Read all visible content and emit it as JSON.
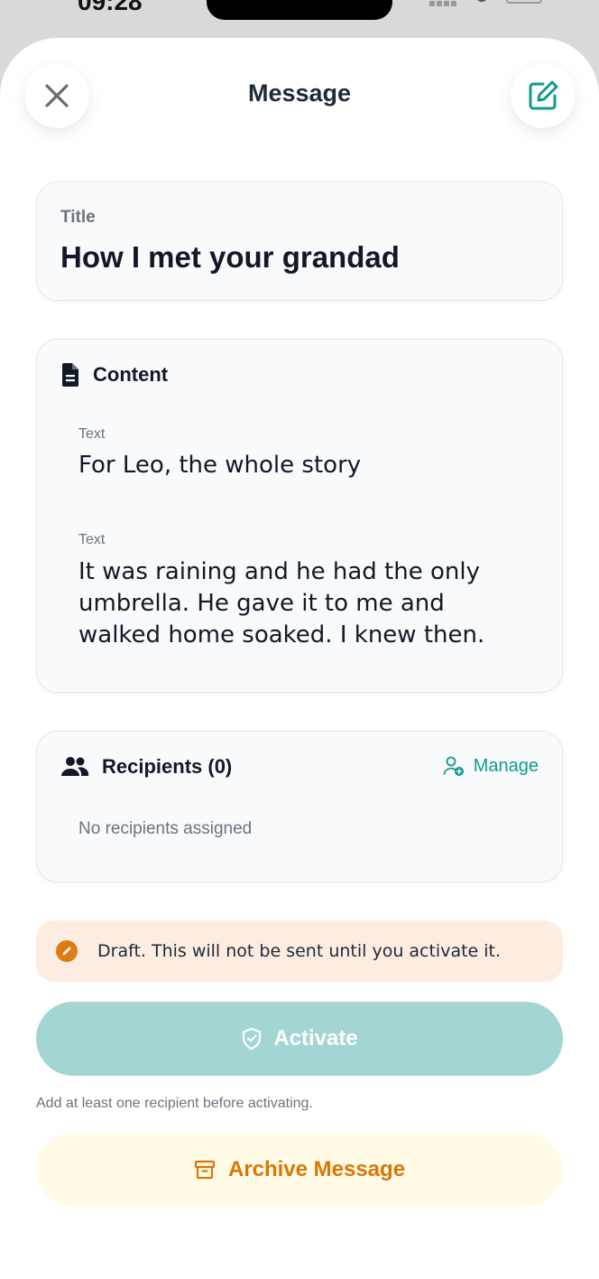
{
  "status_bar": {
    "time": "09:28"
  },
  "header": {
    "title": "Message",
    "close_icon": "close-icon",
    "edit_icon": "edit-icon"
  },
  "title_card": {
    "label": "Title",
    "value": "How I met your grandad"
  },
  "content_card": {
    "heading": "Content",
    "icon": "document-icon",
    "fields": [
      {
        "label": "Text",
        "value": "For Leo, the whole story"
      },
      {
        "label": "Text",
        "value": "It was raining and he had the only umbrella. He gave it to me and walked home soaked. I knew then."
      }
    ]
  },
  "recipients_card": {
    "heading": "Recipients (0)",
    "icon": "users-icon",
    "manage_label": "Manage",
    "empty_text": "No recipients assigned"
  },
  "draft_banner": {
    "text": "Draft. This will not be sent until you activate it.",
    "icon": "pencil-icon"
  },
  "activate": {
    "label": "Activate",
    "hint": "Add at least one recipient before activating.",
    "icon": "shield-check-icon"
  },
  "archive": {
    "label": "Archive Message",
    "icon": "archive-icon"
  },
  "colors": {
    "accent": "#0f9b8e",
    "activate_bg": "#a3d6d2",
    "archive_text": "#d97706",
    "draft_bg": "#fcede0",
    "draft_icon": "#e07b12"
  }
}
